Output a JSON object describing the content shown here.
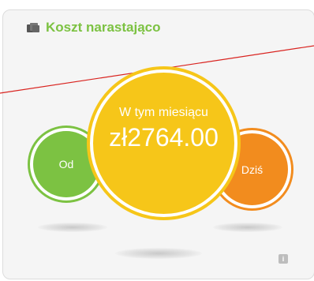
{
  "widget": {
    "title": "Koszt narastająco",
    "title_icon": "folder-stack-icon",
    "left_circle": {
      "label": "Od",
      "color": "#7cc242"
    },
    "main_circle": {
      "label": "W tym miesiącu",
      "value": "zł2764.00",
      "color": "#f6c619"
    },
    "right_circle": {
      "label": "Dziś",
      "color": "#f28c1e"
    },
    "info_icon": "info-icon"
  },
  "colors": {
    "accent_green": "#7cc242",
    "accent_orange": "#f28c1e",
    "accent_yellow": "#f6c619",
    "red_line": "#d9231f"
  }
}
